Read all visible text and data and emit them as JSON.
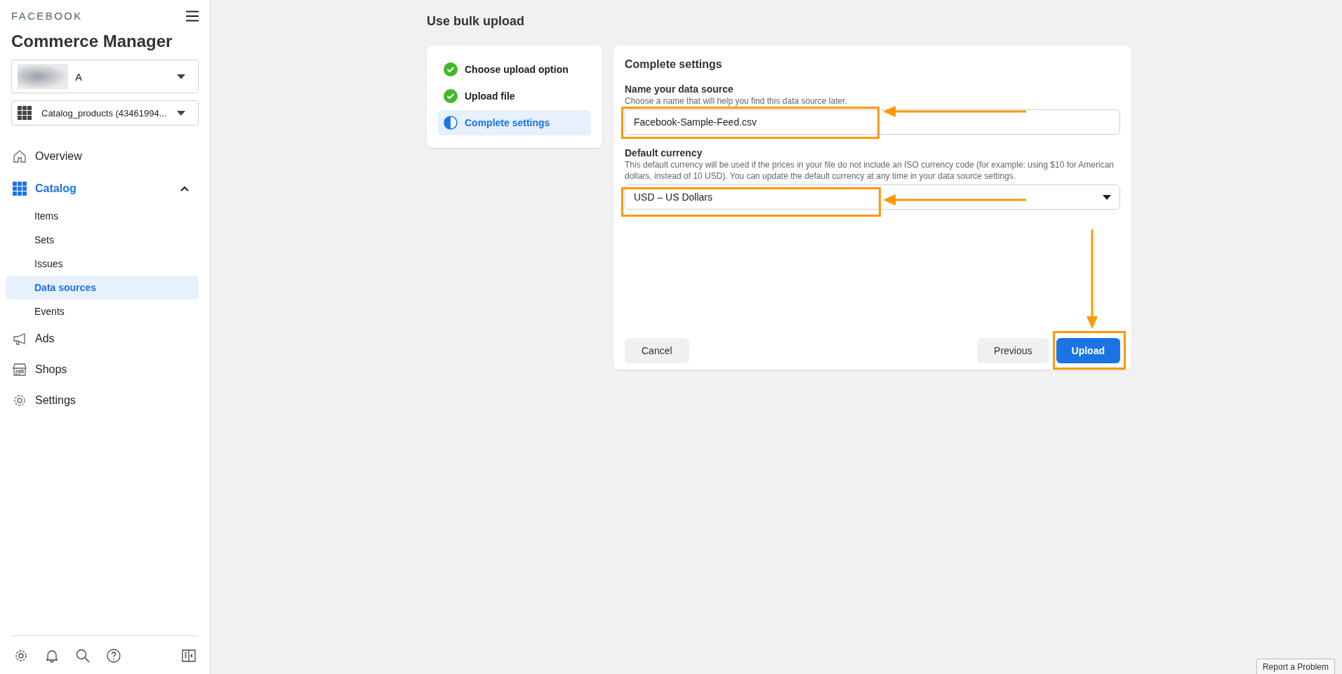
{
  "sidebar": {
    "brand": "FACEBOOK",
    "title": "Commerce Manager",
    "account": {
      "name": "A"
    },
    "catalog": {
      "name": "Catalog_products (43461994..."
    },
    "nav": [
      {
        "kind": "item",
        "label": "Overview",
        "selected": false
      },
      {
        "kind": "section",
        "label": "Catalog",
        "selected": true,
        "expanded": true,
        "children": [
          {
            "label": "Items",
            "selected": false
          },
          {
            "label": "Sets",
            "selected": false
          },
          {
            "label": "Issues",
            "selected": false
          },
          {
            "label": "Data sources",
            "selected": true
          },
          {
            "label": "Events",
            "selected": false
          }
        ]
      },
      {
        "kind": "item",
        "label": "Ads",
        "selected": false
      },
      {
        "kind": "item",
        "label": "Shops",
        "selected": false
      },
      {
        "kind": "item",
        "label": "Settings",
        "selected": false
      }
    ]
  },
  "page_title": "Use bulk upload",
  "steps": [
    {
      "label": "Choose upload option",
      "completed": true,
      "selected": false
    },
    {
      "label": "Upload file",
      "completed": true,
      "selected": false
    },
    {
      "label": "Complete settings",
      "completed": false,
      "selected": true
    }
  ],
  "form": {
    "heading": "Complete settings",
    "name_field": {
      "label": "Name your data source",
      "help": "Choose a name that will help you find this data source later.",
      "value": "Facebook-Sample-Feed.csv"
    },
    "currency_field": {
      "label": "Default currency",
      "help": "This default currency will be used if the prices in your file do not include an ISO currency code (for example: using $10 for American dollars, instead of 10 USD). You can update the default currency at any time in your data source settings.",
      "value": "USD – US Dollars"
    },
    "buttons": {
      "cancel": "Cancel",
      "previous": "Previous",
      "upload": "Upload"
    }
  },
  "report_button": "Report a Problem"
}
